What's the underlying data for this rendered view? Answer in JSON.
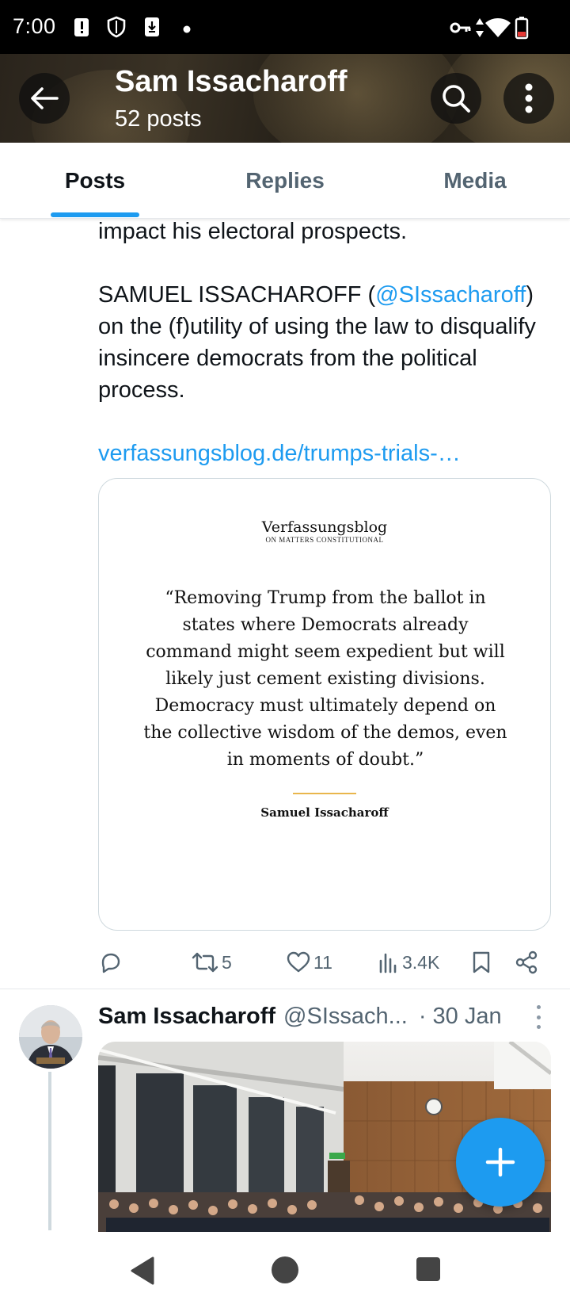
{
  "status_bar": {
    "time": "7:00",
    "left_icons": [
      "alert-icon",
      "shield-icon",
      "download-icon",
      "dot-icon"
    ],
    "right_icons": [
      "vpn-key-icon",
      "data-arrows-icon",
      "wifi-icon",
      "battery-low-icon"
    ]
  },
  "header": {
    "title": "Sam Issacharoff",
    "subtitle": "52 posts",
    "back_icon": "back-arrow-icon",
    "search_icon": "search-icon",
    "more_icon": "more-vertical-icon"
  },
  "tabs": [
    {
      "label": "Posts",
      "active": true
    },
    {
      "label": "Replies",
      "active": false
    },
    {
      "label": "Media",
      "active": false
    }
  ],
  "tweet1": {
    "text_line_top": "impact his electoral prospects.",
    "para_prefix": "SAMUEL ISSACHAROFF (",
    "mention": "@SIssacharoff",
    "para_suffix": ") on the (f)utility of using the law to disqualify insincere democrats from the political process.",
    "link": "verfassungsblog.de/trumps-trials-…",
    "card": {
      "brand": "Verfassungsblog",
      "brand_sub": "ON MATTERS CONSTITUTIONAL",
      "quote": "“Removing Trump from the ballot in states where Democrats already command might seem expedient but will likely just cement existing divisions. Democracy must ultimately depend on the collective wisdom of the demos, even in moments of doubt.”",
      "author": "Samuel Issacharoff",
      "rule_color": "#e9b64c"
    },
    "actions": {
      "reply_count": "",
      "retweets": "5",
      "likes": "11",
      "views": "3.4K"
    }
  },
  "tweet2": {
    "name": "Sam Issacharoff",
    "handle": "@SIssach...",
    "date": "· 30 Jan",
    "media_icon": "lecture-hall-photo"
  },
  "fab_icon": "plus-icon",
  "nav": [
    "back-triangle-icon",
    "home-circle-icon",
    "recents-square-icon"
  ],
  "colors": {
    "accent": "#1d9bf0",
    "text_primary": "#0f1419",
    "text_secondary": "#536471"
  }
}
